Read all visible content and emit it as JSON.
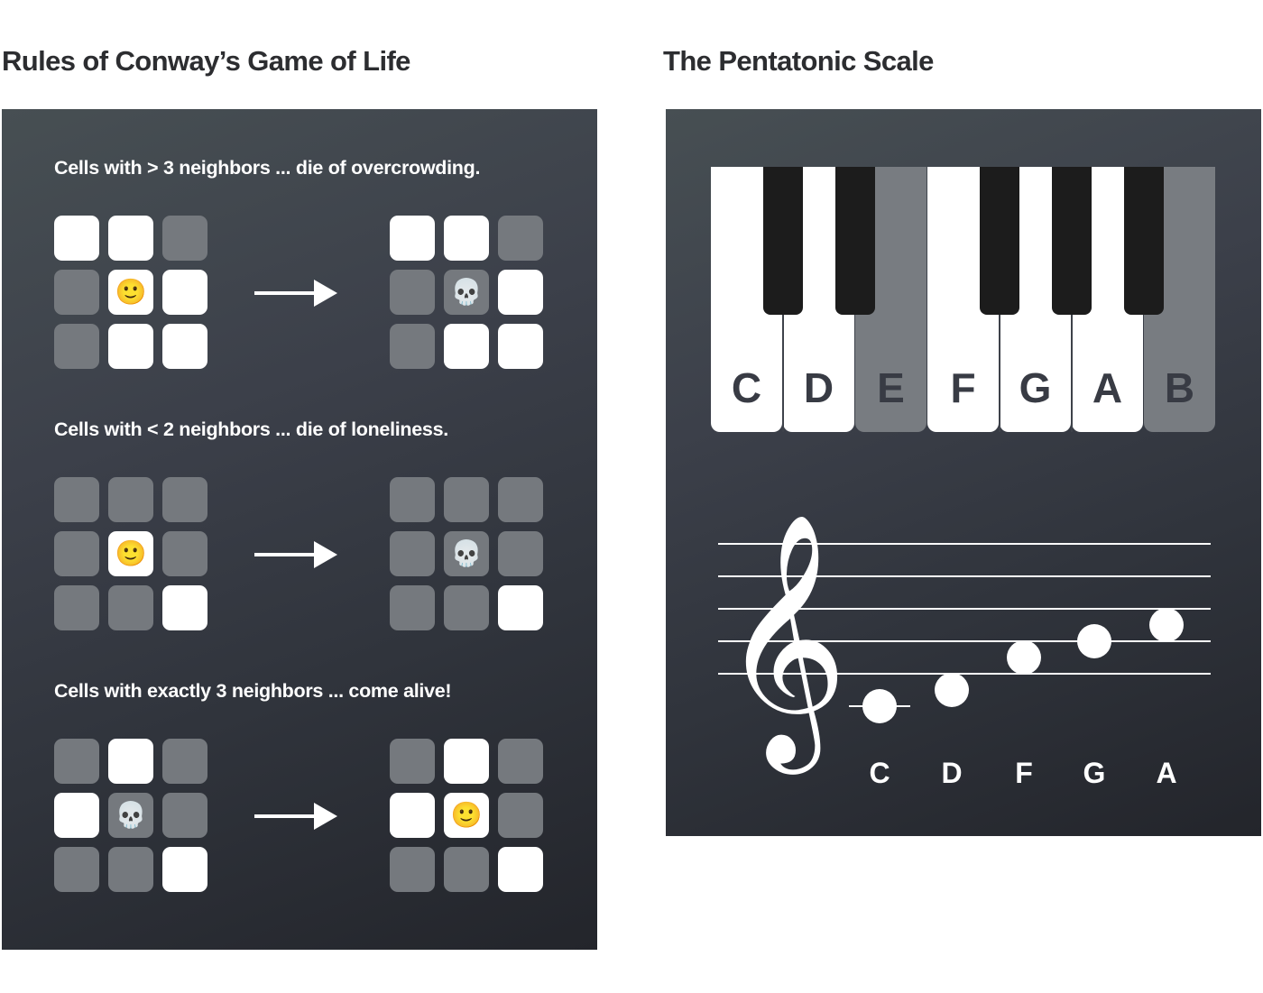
{
  "left": {
    "title": "Rules of Conway’s Game of Life",
    "rules": [
      {
        "caption": "Cells with > 3 neighbors ... die of overcrowding.",
        "before": [
          1,
          1,
          0,
          0,
          "smile",
          1,
          0,
          1,
          1
        ],
        "after": [
          1,
          1,
          0,
          0,
          "skull",
          1,
          0,
          1,
          1
        ]
      },
      {
        "caption": "Cells with < 2 neighbors ... die of loneliness.",
        "before": [
          0,
          0,
          0,
          0,
          "smile",
          0,
          0,
          0,
          1
        ],
        "after": [
          0,
          0,
          0,
          0,
          "skull",
          0,
          0,
          0,
          1
        ]
      },
      {
        "caption": "Cells with exactly 3 neighbors ... come alive!",
        "before": [
          0,
          1,
          0,
          1,
          "skull",
          0,
          0,
          0,
          1
        ],
        "after": [
          0,
          1,
          0,
          1,
          "smile",
          0,
          0,
          0,
          1
        ]
      }
    ],
    "icons": {
      "smile": "🙂",
      "skull": "💀"
    }
  },
  "right": {
    "title": "The Pentatonic Scale",
    "piano_keys": [
      {
        "note": "C",
        "in_scale": true
      },
      {
        "note": "D",
        "in_scale": true
      },
      {
        "note": "E",
        "in_scale": false
      },
      {
        "note": "F",
        "in_scale": true
      },
      {
        "note": "G",
        "in_scale": true
      },
      {
        "note": "A",
        "in_scale": true
      },
      {
        "note": "B",
        "in_scale": false
      }
    ],
    "staff_notes": [
      "C",
      "D",
      "F",
      "G",
      "A"
    ],
    "clef": "treble-clef"
  },
  "colors": {
    "alive": "#ffffff",
    "dead": "#75797e",
    "black_key": "#1c1c1c",
    "off_key": "#787c81",
    "label_dark": "#383b44"
  }
}
